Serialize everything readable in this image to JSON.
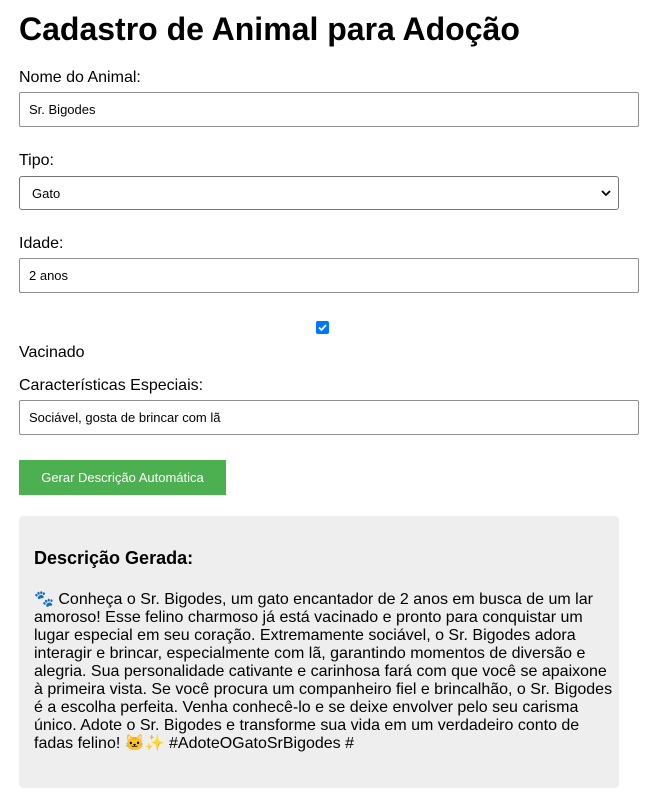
{
  "page": {
    "title": "Cadastro de Animal para Adoção"
  },
  "form": {
    "name_label": "Nome do Animal:",
    "name_value": "Sr. Bigodes",
    "type_label": "Tipo:",
    "type_value": "Gato",
    "age_label": "Idade:",
    "age_value": "2 anos",
    "vaccinated_label": "Vacinado",
    "vaccinated_checked": true,
    "features_label": "Características Especiais:",
    "features_value": "Sociável, gosta de brincar com lã",
    "generate_button": "Gerar Descrição Automática"
  },
  "result": {
    "heading": "Descrição Gerada:",
    "text": "🐾 Conheça o Sr. Bigodes, um gato encantador de 2 anos em busca de um lar amoroso! Esse felino charmoso já está vacinado e pronto para conquistar um lugar especial em seu coração. Extremamente sociável, o Sr. Bigodes adora interagir e brincar, especialmente com lã, garantindo momentos de diversão e alegria. Sua personalidade cativante e carinhosa fará com que você se apaixone à primeira vista. Se você procura um companheiro fiel e brincalhão, o Sr. Bigodes é a escolha perfeita. Venha conhecê-lo e se deixe envolver pelo seu carisma único. Adote o Sr. Bigodes e transforme sua vida em um verdadeiro conto de fadas felino! 🐱✨ #AdoteOGatoSrBigodes #"
  },
  "colors": {
    "button": "#4caf50",
    "checkbox": "#0075ff",
    "result_bg": "#eeeeee"
  }
}
